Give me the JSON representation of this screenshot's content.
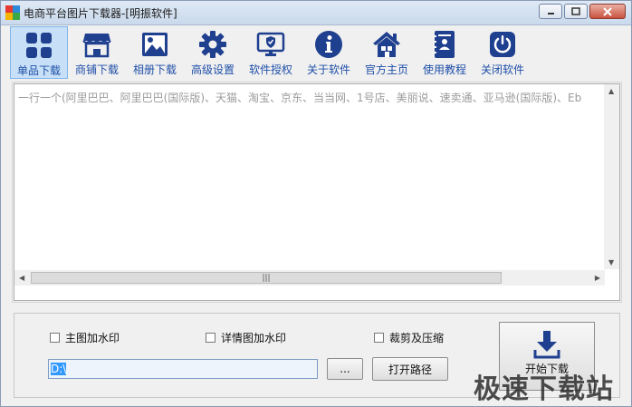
{
  "window": {
    "title": "电商平台图片下载器-[明振软件]"
  },
  "toolbar": {
    "items": [
      {
        "label": "单品下载",
        "icon": "grid-icon",
        "active": true
      },
      {
        "label": "商铺下载",
        "icon": "store-icon"
      },
      {
        "label": "相册下载",
        "icon": "image-icon"
      },
      {
        "label": "高级设置",
        "icon": "gear-icon"
      },
      {
        "label": "软件授权",
        "icon": "monitor-shield-icon"
      },
      {
        "label": "关于软件",
        "icon": "info-icon"
      },
      {
        "label": "官方主页",
        "icon": "home-icon"
      },
      {
        "label": "使用教程",
        "icon": "book-icon"
      },
      {
        "label": "关闭软件",
        "icon": "power-icon"
      }
    ]
  },
  "url_area": {
    "placeholder": "一行一个(阿里巴巴、阿里巴巴(国际版)、天猫、淘宝、京东、当当网、1号店、美丽说、速卖通、亚马逊(国际版)、Eb"
  },
  "options": {
    "main_watermark": {
      "label": "主图加水印",
      "checked": false
    },
    "detail_watermark": {
      "label": "详情图加水印",
      "checked": false
    },
    "crop_compress": {
      "label": "裁剪及压缩",
      "checked": false
    }
  },
  "path": {
    "value": "D:\\"
  },
  "buttons": {
    "browse": "...",
    "open_path": "打开路径",
    "start_download": "开始下载"
  },
  "watermark_text": "极速下载站",
  "colors": {
    "icon_blue": "#1f3f8f",
    "label_blue": "#1f4fa8",
    "active_bg": "#c7e0f7"
  }
}
